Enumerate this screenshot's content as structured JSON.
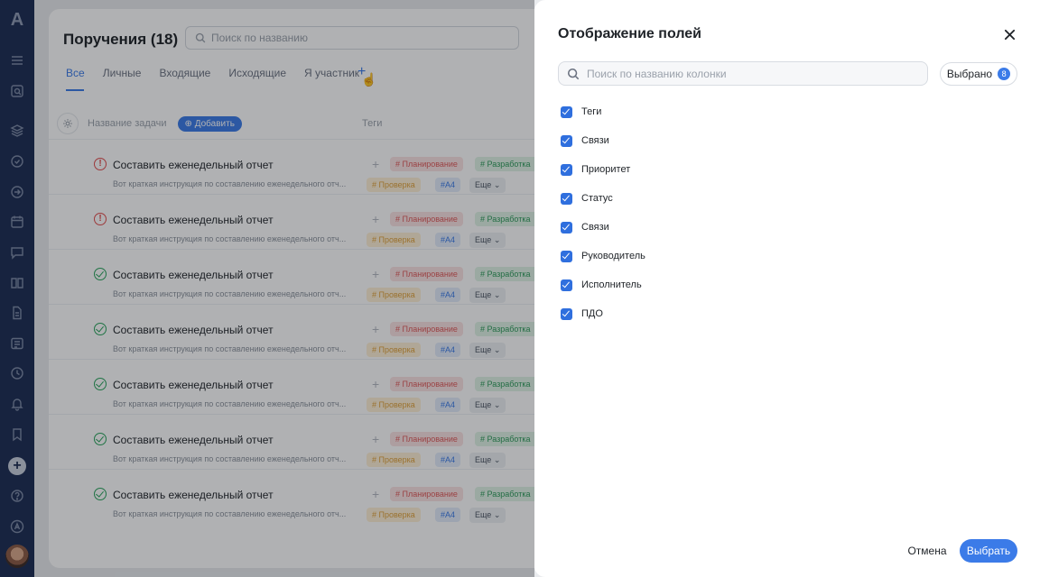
{
  "app": {
    "logo_glyph": "A"
  },
  "rail": {
    "icons": [
      "menu-icon",
      "search-doc-icon",
      "layers-icon",
      "check-circle-icon",
      "arrow-right-circle-icon",
      "calendar-icon",
      "chat-icon",
      "book-icon",
      "document-icon",
      "newspaper-icon",
      "clock-icon",
      "bell-icon",
      "bookmark-icon",
      "add-icon",
      "help-icon",
      "logo-small-icon",
      "avatar"
    ]
  },
  "main": {
    "title": "Поручения (18)",
    "search_placeholder": "Поиск по названию",
    "tabs": [
      "Все",
      "Личные",
      "Входящие",
      "Исходящие",
      "Я участник"
    ],
    "tab_add": "+",
    "table": {
      "col_task": "Название задачи",
      "add_label": "Добавить",
      "col_tags": "Теги"
    },
    "rows": [
      {
        "status": "warn",
        "title": "Составить еженедельный отчет",
        "desc": "Вот краткая инструкция по составлению еженедельного отч...",
        "tag_plan": "# Планирование",
        "tag_dev": "# Разработка",
        "tag_check": "# Проверка",
        "tag_a4": "#A4",
        "more": "Еще"
      },
      {
        "status": "warn",
        "title": "Составить еженедельный отчет",
        "desc": "Вот краткая инструкция по составлению еженедельного отч...",
        "tag_plan": "# Планирование",
        "tag_dev": "# Разработка",
        "tag_check": "# Проверка",
        "tag_a4": "#A4",
        "more": "Еще"
      },
      {
        "status": "done",
        "title": "Составить еженедельный отчет",
        "desc": "Вот краткая инструкция по составлению еженедельного отч...",
        "tag_plan": "# Планирование",
        "tag_dev": "# Разработка",
        "tag_check": "# Проверка",
        "tag_a4": "#A4",
        "more": "Еще"
      },
      {
        "status": "done",
        "title": "Составить еженедельный отчет",
        "desc": "Вот краткая инструкция по составлению еженедельного отч...",
        "tag_plan": "# Планирование",
        "tag_dev": "# Разработка",
        "tag_check": "# Проверка",
        "tag_a4": "#A4",
        "more": "Еще"
      },
      {
        "status": "done",
        "title": "Составить еженедельный отчет",
        "desc": "Вот краткая инструкция по составлению еженедельного отч...",
        "tag_plan": "# Планирование",
        "tag_dev": "# Разработка",
        "tag_check": "# Проверка",
        "tag_a4": "#A4",
        "more": "Еще"
      },
      {
        "status": "done",
        "title": "Составить еженедельный отчет",
        "desc": "Вот краткая инструкция по составлению еженедельного отч...",
        "tag_plan": "# Планирование",
        "tag_dev": "# Разработка",
        "tag_check": "# Проверка",
        "tag_a4": "#A4",
        "more": "Еще"
      },
      {
        "status": "done",
        "title": "Составить еженедельный отчет",
        "desc": "Вот краткая инструкция по составлению еженедельного отч...",
        "tag_plan": "# Планирование",
        "tag_dev": "# Разработка",
        "tag_check": "# Проверка",
        "tag_a4": "#A4",
        "more": "Еще"
      }
    ]
  },
  "panel": {
    "title": "Отображение полей",
    "search_placeholder": "Поиск по названию колонки",
    "selected_label": "Выбрано",
    "selected_count": "8",
    "fields": [
      {
        "label": "Теги",
        "checked": true
      },
      {
        "label": "Связи",
        "checked": true
      },
      {
        "label": "Приоритет",
        "checked": true
      },
      {
        "label": "Статус",
        "checked": true
      },
      {
        "label": "Связи",
        "checked": true
      },
      {
        "label": "Руководитель",
        "checked": true
      },
      {
        "label": "Исполнитель",
        "checked": true
      },
      {
        "label": "ПДО",
        "checked": true
      }
    ],
    "cancel_label": "Отмена",
    "submit_label": "Выбрать"
  },
  "colors": {
    "accent": "#3b7be8",
    "rail_bg": "#1c2c52",
    "checkbox": "#2f6fde"
  }
}
